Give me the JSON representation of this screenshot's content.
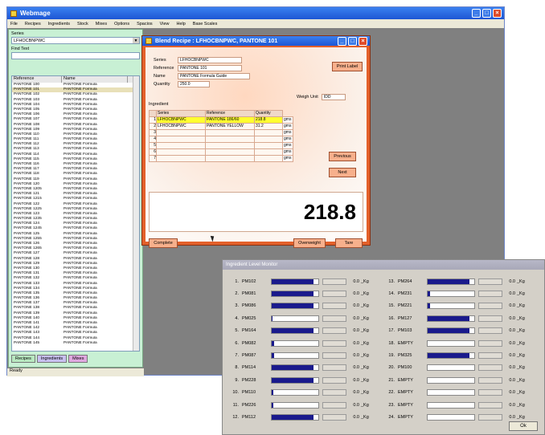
{
  "app": {
    "title": "Webmage",
    "menu": [
      "File",
      "Recipes",
      "Ingredients",
      "Stock",
      "Mixes",
      "Options",
      "Spacios",
      "View",
      "Help",
      "Base Scales"
    ],
    "status": "Ready"
  },
  "left": {
    "series_label": "Series",
    "series_value": "LFHOCBNPWC",
    "find_label": "Find Text",
    "list_cols": [
      "Reference",
      "Name"
    ],
    "rows": [
      [
        "PANTONE 100",
        "PANTONE Formula"
      ],
      [
        "PANTONE 101",
        "PANTONE Formula"
      ],
      [
        "PANTONE 102",
        "PANTONE Formula"
      ],
      [
        "PANTONE 103",
        "PANTONE Formula"
      ],
      [
        "PANTONE 104",
        "PANTONE Formula"
      ],
      [
        "PANTONE 105",
        "PANTONE Formula"
      ],
      [
        "PANTONE 106",
        "PANTONE Formula"
      ],
      [
        "PANTONE 107",
        "PANTONE Formula"
      ],
      [
        "PANTONE 108",
        "PANTONE Formula"
      ],
      [
        "PANTONE 109",
        "PANTONE Formula"
      ],
      [
        "PANTONE 110",
        "PANTONE Formula"
      ],
      [
        "PANTONE 111",
        "PANTONE Formula"
      ],
      [
        "PANTONE 112",
        "PANTONE Formula"
      ],
      [
        "PANTONE 113",
        "PANTONE Formula"
      ],
      [
        "PANTONE 114",
        "PANTONE Formula"
      ],
      [
        "PANTONE 115",
        "PANTONE Formula"
      ],
      [
        "PANTONE 116",
        "PANTONE Formula"
      ],
      [
        "PANTONE 117",
        "PANTONE Formula"
      ],
      [
        "PANTONE 118",
        "PANTONE Formula"
      ],
      [
        "PANTONE 119",
        "PANTONE Formula"
      ],
      [
        "PANTONE 120",
        "PANTONE Formula"
      ],
      [
        "PANTONE 1205",
        "PANTONE Formula"
      ],
      [
        "PANTONE 121",
        "PANTONE Formula"
      ],
      [
        "PANTONE 1215",
        "PANTONE Formula"
      ],
      [
        "PANTONE 122",
        "PANTONE Formula"
      ],
      [
        "PANTONE 1225",
        "PANTONE Formula"
      ],
      [
        "PANTONE 123",
        "PANTONE Formula"
      ],
      [
        "PANTONE 1235",
        "PANTONE Formula"
      ],
      [
        "PANTONE 124",
        "PANTONE Formula"
      ],
      [
        "PANTONE 1245",
        "PANTONE Formula"
      ],
      [
        "PANTONE 125",
        "PANTONE Formula"
      ],
      [
        "PANTONE 1255",
        "PANTONE Formula"
      ],
      [
        "PANTONE 126",
        "PANTONE Formula"
      ],
      [
        "PANTONE 1265",
        "PANTONE Formula"
      ],
      [
        "PANTONE 127",
        "PANTONE Formula"
      ],
      [
        "PANTONE 128",
        "PANTONE Formula"
      ],
      [
        "PANTONE 129",
        "PANTONE Formula"
      ],
      [
        "PANTONE 130",
        "PANTONE Formula"
      ],
      [
        "PANTONE 131",
        "PANTONE Formula"
      ],
      [
        "PANTONE 132",
        "PANTONE Formula"
      ],
      [
        "PANTONE 133",
        "PANTONE Formula"
      ],
      [
        "PANTONE 134",
        "PANTONE Formula"
      ],
      [
        "PANTONE 135",
        "PANTONE Formula"
      ],
      [
        "PANTONE 136",
        "PANTONE Formula"
      ],
      [
        "PANTONE 137",
        "PANTONE Formula"
      ],
      [
        "PANTONE 138",
        "PANTONE Formula"
      ],
      [
        "PANTONE 139",
        "PANTONE Formula"
      ],
      [
        "PANTONE 140",
        "PANTONE Formula"
      ],
      [
        "PANTONE 141",
        "PANTONE Formula"
      ],
      [
        "PANTONE 142",
        "PANTONE Formula"
      ],
      [
        "PANTONE 143",
        "PANTONE Formula"
      ],
      [
        "PANTONE 144",
        "PANTONE Formula"
      ],
      [
        "PANTONE 145",
        "PANTONE Formula"
      ]
    ],
    "tabs": [
      "Recipes",
      "Ingredients",
      "Mixes"
    ]
  },
  "blend": {
    "title": "Blend Recipe : LFHOCBNPWC, PANTONE 101",
    "fields": [
      [
        "Series",
        "LFHOCBNPWC"
      ],
      [
        "Reference",
        "PANTONE 101"
      ],
      [
        "Name",
        "PANTONE Formula Guide"
      ],
      [
        "Quantity",
        "250.0"
      ]
    ],
    "print_label": "Print Label",
    "weigh_unit_label": "Weigh Unit",
    "weigh_unit_value": "IDD",
    "ingredients_label": "Ingredient",
    "grid_cols": [
      "Series",
      "Reference",
      "Quantity"
    ],
    "grid_rows": [
      [
        "1",
        "LFHOCBNPWC",
        "PANTONE 186/60",
        "218.8",
        "gms"
      ],
      [
        "2",
        "LFHOCBNPWC",
        "PANTONE YELLOW",
        "31.2",
        "gms"
      ],
      [
        "3",
        "",
        "",
        "",
        "gms"
      ],
      [
        "4",
        "",
        "",
        "",
        "gms"
      ],
      [
        "5",
        "",
        "",
        "",
        "gms"
      ],
      [
        "6",
        "",
        "",
        "",
        "gms"
      ],
      [
        "7",
        "",
        "",
        "",
        "gms"
      ]
    ],
    "previous": "Previous",
    "next": "Next",
    "big_value": "218.8",
    "complete": "Complete",
    "overweight": "Overweight",
    "tare": "Tare"
  },
  "levels": {
    "title": "Ingredient Level Monitor",
    "ok": "Ok",
    "left": [
      [
        "1.",
        "PM102",
        0.9,
        "0.0",
        "_Kg"
      ],
      [
        "2.",
        "PM081",
        0.9,
        "0.0",
        "_Kg"
      ],
      [
        "3.",
        "PM086",
        0.9,
        "0.0",
        "_Kg"
      ],
      [
        "4.",
        "PM025",
        0.02,
        "0.0",
        "_Kg"
      ],
      [
        "5.",
        "PM164",
        0.9,
        "0.0",
        "_Kg"
      ],
      [
        "6.",
        "PM082",
        0.05,
        "0.0",
        "_Kg"
      ],
      [
        "7.",
        "PM087",
        0.05,
        "0.0",
        "_Kg"
      ],
      [
        "8.",
        "PM114",
        0.9,
        "0.0",
        "_Kg"
      ],
      [
        "9.",
        "PM228",
        0.9,
        "0.0",
        "_Kg"
      ],
      [
        "10.",
        "PM110",
        0.03,
        "0.0",
        "_Kg"
      ],
      [
        "11.",
        "PM226",
        0.03,
        "0.0",
        "_Kg"
      ],
      [
        "12.",
        "PM112",
        0.9,
        "0.0",
        "_Kg"
      ]
    ],
    "right": [
      [
        "13.",
        "PM264",
        0.9,
        "0.0",
        "_Kg"
      ],
      [
        "14.",
        "PM231",
        0.05,
        "0.0",
        "_Kg"
      ],
      [
        "15.",
        "PM221",
        0.05,
        "0.0",
        "_Kg"
      ],
      [
        "16.",
        "PM127",
        0.9,
        "0.0",
        "_Kg"
      ],
      [
        "17.",
        "PM103",
        0.9,
        "0.0",
        "_Kg"
      ],
      [
        "18.",
        "EMPTY",
        0,
        "0.0",
        "_Kg"
      ],
      [
        "19.",
        "PM325",
        0.9,
        "0.0",
        "_Kg"
      ],
      [
        "20.",
        "PM100",
        0,
        "0.0",
        "_Kg"
      ],
      [
        "21.",
        "EMPTY",
        0,
        "0.0",
        "_Kg"
      ],
      [
        "22.",
        "EMPTY",
        0,
        "0.0",
        "_Kg"
      ],
      [
        "23.",
        "EMPTY",
        0,
        "0.0",
        "_Kg"
      ],
      [
        "24.",
        "EMPTY",
        0,
        "0.0",
        "_Kg"
      ]
    ]
  },
  "colors": {
    "accent": "#e3602a",
    "bar": "#1a1a8c",
    "highlight": "#ffff30"
  }
}
